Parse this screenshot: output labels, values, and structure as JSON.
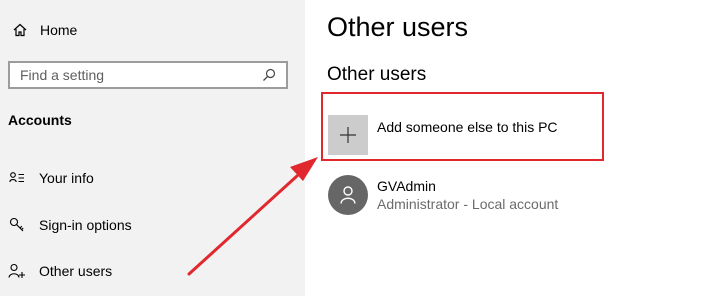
{
  "sidebar": {
    "home": {
      "label": "Home",
      "icon": "home-icon"
    },
    "search": {
      "placeholder": "Find a setting",
      "value": "",
      "icon": "search-icon"
    },
    "section_title": "Accounts",
    "items": [
      {
        "label": "Your info",
        "icon": "person-card-icon"
      },
      {
        "label": "Sign-in options",
        "icon": "key-icon"
      },
      {
        "label": "Other users",
        "icon": "add-person-icon"
      }
    ]
  },
  "main": {
    "title": "Other users",
    "subtitle": "Other users",
    "add_user": {
      "label": "Add someone else to this PC",
      "icon": "plus-icon"
    },
    "user": {
      "name": "GVAdmin",
      "role": "Administrator - Local account",
      "icon": "user-avatar-icon"
    }
  },
  "colors": {
    "sidebar_bg": "#f2f2f2",
    "highlight": "#e0282e",
    "arrow": "#e0282e",
    "plus_box": "#cccccc",
    "avatar": "#666666"
  }
}
